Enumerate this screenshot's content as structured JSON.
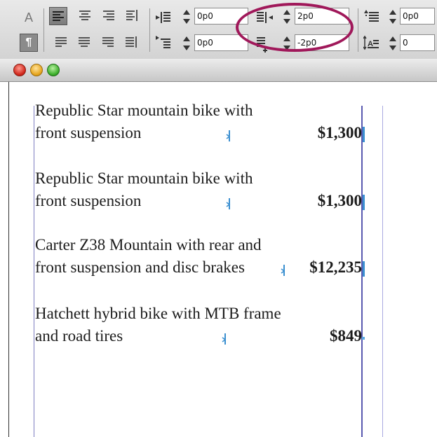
{
  "control_panel": {
    "char_mode_label": "A",
    "para_mode_label": "¶",
    "left_indent": "0p0",
    "first_line_indent": "0p0",
    "right_indent": "2p0",
    "last_line_right_indent": "-2p0",
    "space_before": "0p0",
    "drop_cap_lines": "0",
    "highlight_color": "#a0185a"
  },
  "window": {
    "close_icon": "close-icon",
    "minimize_icon": "minimize-icon",
    "zoom_icon": "zoom-icon"
  },
  "document": {
    "entries": [
      {
        "line1": "Republic Star mountain bike with",
        "line2": "front suspension",
        "price": "$1,300"
      },
      {
        "line1": "Republic Star mountain bike with",
        "line2": "front suspension",
        "price": "$1,300"
      },
      {
        "line1": "Carter Z38 Mountain with rear and",
        "line2": "front suspension and disc brakes",
        "price": "$12,235"
      },
      {
        "line1": "Hatchett hybrid bike with MTB frame",
        "line2": "and road tires",
        "price": "$849"
      }
    ]
  }
}
